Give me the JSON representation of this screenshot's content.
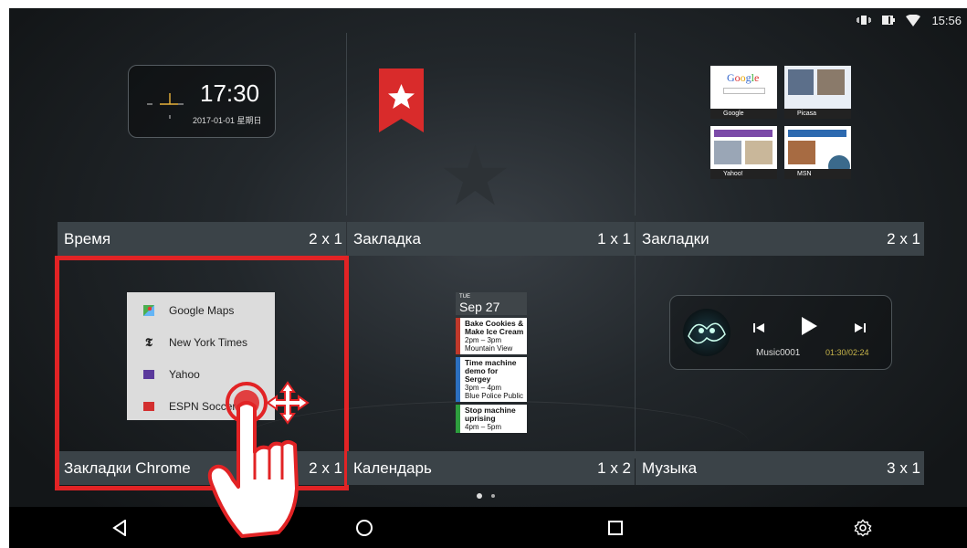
{
  "status_bar": {
    "time": "15:56",
    "icons": [
      "vibrate-icon",
      "battery-icon",
      "wifi-icon"
    ]
  },
  "widgets": [
    {
      "name": "Время",
      "size": "2 x 1"
    },
    {
      "name": "Закладка",
      "size": "1 x 1"
    },
    {
      "name": "Закладки",
      "size": "2 x 1"
    },
    {
      "name": "Закладки Chrome",
      "size": "2 x 1"
    },
    {
      "name": "Календарь",
      "size": "1 x 2"
    },
    {
      "name": "Музыка",
      "size": "3 x 1"
    }
  ],
  "clock_widget": {
    "time": "17:30",
    "date": "2017-01-01  星期日"
  },
  "bookmarks_thumbs": [
    "Google",
    "Picasa",
    "Yahoo!",
    "MSN"
  ],
  "chrome_bookmarks": [
    {
      "label": "Google Maps",
      "icon": "maps-icon"
    },
    {
      "label": "New York Times",
      "icon": "nyt-icon"
    },
    {
      "label": "Yahoo",
      "icon": "yahoo-icon"
    },
    {
      "label": "ESPN Soccer",
      "icon": "espn-icon"
    }
  ],
  "calendar": {
    "dow": "TUE",
    "date": "Sep 27",
    "events": [
      {
        "title": "Bake Cookies & Make Ice Cream",
        "time": "2pm – 3pm",
        "place": "Mountain View",
        "color": "#c0392b"
      },
      {
        "title": "Time machine demo for Sergey",
        "time": "3pm – 4pm",
        "place": "Blue Police Public",
        "color": "#2c6fbf"
      },
      {
        "title": "Stop machine uprising",
        "time": "4pm – 5pm",
        "place": "",
        "color": "#2e9e3e"
      }
    ]
  },
  "music": {
    "title": "Music0001",
    "progress": "01:30/02:24"
  },
  "pager": {
    "dots": 2,
    "active": 0
  },
  "navbar": [
    "back-icon",
    "home-icon",
    "recents-icon",
    "settings-icon"
  ],
  "colors": {
    "highlight": "#e22325",
    "label_bar": "#3b4348",
    "bookmark_red": "#d92b2b"
  }
}
